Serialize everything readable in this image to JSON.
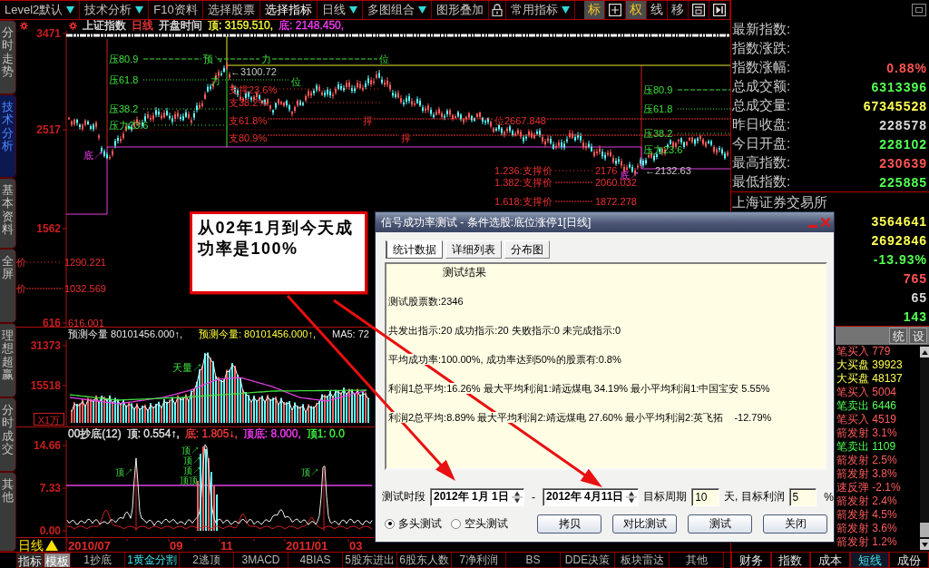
{
  "toolbar": {
    "items": [
      {
        "kind": "menu",
        "label": "Level2默认",
        "dropdown": true,
        "selected": false
      },
      {
        "kind": "menu",
        "label": "技术分析",
        "dropdown": true,
        "selected": false
      },
      {
        "kind": "menu",
        "label": "F10资料",
        "dropdown": false,
        "selected": false
      },
      {
        "kind": "menu",
        "label": "选择股票",
        "dropdown": false,
        "selected": false
      },
      {
        "kind": "menu",
        "label": "选择指标",
        "dropdown": false,
        "selected": true
      },
      {
        "kind": "menu",
        "label": "日线",
        "dropdown": true,
        "selected": false
      },
      {
        "kind": "menu",
        "label": "多图组合",
        "dropdown": true,
        "selected": false
      },
      {
        "kind": "menu",
        "label": "图形叠加",
        "dropdown": false,
        "selected": false
      },
      {
        "kind": "lock"
      },
      {
        "kind": "menu",
        "label": "常用指标",
        "dropdown": true,
        "selected": false
      }
    ],
    "tools": [
      {
        "kind": "text",
        "label": "标",
        "active": true
      },
      {
        "kind": "grid",
        "active": false
      },
      {
        "kind": "text",
        "label": "权",
        "active": true
      },
      {
        "kind": "text",
        "label": "线",
        "active": false
      },
      {
        "kind": "text",
        "label": "移",
        "active": false
      },
      {
        "kind": "window",
        "active": false
      },
      {
        "kind": "step",
        "active": false
      }
    ]
  },
  "side_tabs": [
    {
      "label": "分时走势",
      "selected": false
    },
    {
      "label": "技术分析",
      "selected": true
    },
    {
      "label": "基本资料",
      "selected": false
    },
    {
      "label": "全屏",
      "selected": false
    },
    {
      "label": "理想超赢",
      "selected": false
    },
    {
      "label": "分时成交",
      "selected": false
    },
    {
      "label": "其他",
      "selected": false
    }
  ],
  "main_chart": {
    "header": [
      {
        "text": "上证指数",
        "color": "#e8e8e8"
      },
      {
        "text": "日线",
        "color": "#ff3c3c"
      },
      {
        "text": "开盘时间",
        "color": "#e8e8e8"
      },
      {
        "text": "顶: 3159.510,",
        "color": "#ffff3c"
      },
      {
        "text": "底: 2148.450,",
        "color": "#ff3cff"
      }
    ],
    "axis_labels": [
      "3471",
      "2517",
      "1562",
      "616"
    ],
    "annotations": [
      {
        "text": "压80.9",
        "kind": "resistance"
      },
      {
        "text": "预↘",
        "kind": "resistance"
      },
      {
        "text": "力",
        "kind": "resistance"
      },
      {
        "text": "位",
        "kind": "resistance"
      },
      {
        "text": "←3100.72",
        "kind": "price"
      },
      {
        "text": "压61.8",
        "kind": "resistance"
      },
      {
        "text": "力",
        "kind": "resistance"
      },
      {
        "text": "位",
        "kind": "resistance"
      },
      {
        "text": "支撑23.6%",
        "kind": "support"
      },
      {
        "text": "支38.2%",
        "kind": "support"
      },
      {
        "text": "压38.2",
        "kind": "resistance"
      },
      {
        "text": "支61.8%",
        "kind": "support"
      },
      {
        "text": "撑",
        "kind": "support"
      },
      {
        "text": "位2667.848",
        "kind": "support"
      },
      {
        "text": "压力23.6",
        "kind": "resistance"
      },
      {
        "text": "支80.9%",
        "kind": "support"
      },
      {
        "text": "撑",
        "kind": "support"
      },
      {
        "text": "压80.9",
        "kind": "resistance"
      },
      {
        "text": "压61.8",
        "kind": "resistance"
      },
      {
        "text": "压38.2",
        "kind": "resistance"
      },
      {
        "text": "压力23.6",
        "kind": "resistance"
      },
      {
        "text": "底↗",
        "kind": "bottom"
      },
      {
        "text": "1.236:支撑价",
        "kind": "support"
      },
      {
        "text": "2176",
        "kind": "support"
      },
      {
        "text": "底↗",
        "kind": "bottom"
      },
      {
        "text": "←2132.63",
        "kind": "price"
      },
      {
        "text": "1.382:支撑价",
        "kind": "support"
      },
      {
        "text": "2060.032",
        "kind": "support"
      },
      {
        "text": "1.618:支撑价",
        "kind": "support"
      },
      {
        "text": "1872.278",
        "kind": "support"
      },
      {
        "text": "价",
        "kind": "support"
      },
      {
        "text": "1290.221",
        "kind": "support"
      },
      {
        "text": "价",
        "kind": "support"
      },
      {
        "text": "1032.569",
        "kind": "support"
      },
      {
        "text": "616.001",
        "kind": "support"
      }
    ]
  },
  "volume_chart": {
    "header": [
      {
        "text": "预测今量 80101456.000↑,",
        "color": "#e8e8e8"
      },
      {
        "text": "预测今量: 80101456.000↑,",
        "color": "#ffff3c"
      },
      {
        "text": "MA5: 72",
        "color": "#e8e8e8"
      }
    ],
    "axis_labels": [
      "31373",
      "15518"
    ],
    "unit": "X1万",
    "annotations": [
      "天量↗"
    ]
  },
  "indicator_chart": {
    "header": [
      {
        "text": "00抄底(12)",
        "color": "#e8e8e8"
      },
      {
        "text": "顶: 0.554↑,",
        "color": "#e8e8e8"
      },
      {
        "text": "底: 1.805↓,",
        "color": "#ff3c3c"
      },
      {
        "text": "顶底: 8.000,",
        "color": "#ff3cff"
      },
      {
        "text": "顶1: 0.0",
        "color": "#3cff3c"
      }
    ],
    "axis_labels": [
      "14.66",
      "7.33",
      "0.00"
    ],
    "annotations": [
      "顶↗",
      "顶↗",
      "顶↗",
      "顶↗",
      "顶顶",
      "顶↗"
    ]
  },
  "date_axis": {
    "period": "日线",
    "dates": [
      "2010/07",
      "09",
      "11",
      "2011/01",
      "03"
    ]
  },
  "bottom_bar": {
    "modes": [
      {
        "label": "指标",
        "selected": false
      },
      {
        "label": "模板",
        "selected": true
      }
    ],
    "tabs": [
      {
        "label": "1抄底",
        "selected": false
      },
      {
        "label": "1黄金分割",
        "selected": true
      },
      {
        "label": "2逃顶",
        "selected": false
      },
      {
        "label": "3MACD",
        "selected": false
      },
      {
        "label": "4BIAS",
        "selected": false
      },
      {
        "label": "5股东进出",
        "selected": false
      },
      {
        "label": "6股东人数",
        "selected": false
      },
      {
        "label": "7净利润",
        "selected": false
      },
      {
        "label": "BS",
        "selected": false
      },
      {
        "label": "DDE决策",
        "selected": false
      },
      {
        "label": "板块雷达",
        "selected": false
      },
      {
        "label": "其他",
        "selected": false
      }
    ]
  },
  "quote_panel": {
    "rows": [
      {
        "label": "最新指数:"
      },
      {
        "label": "指数涨跌:"
      },
      {
        "label": "指数涨幅:",
        "value": "0.88%",
        "color": "#ff5454"
      },
      {
        "label": "总成交额:",
        "value": "6313396",
        "color": "#54ff54"
      },
      {
        "label": "总成交量:",
        "value": "67345528",
        "color": "#ffff54"
      },
      {
        "label": "昨日收盘:",
        "value": "228578",
        "color": "#d8d8d8"
      },
      {
        "label": "今日开盘:",
        "value": "228102",
        "color": "#54ff54"
      },
      {
        "label": "最高指数:",
        "value": "230639",
        "color": "#ff5454"
      },
      {
        "label": "最低指数:",
        "value": "225885",
        "color": "#54ff54"
      }
    ],
    "exchange": "上海证券交易所",
    "values": [
      {
        "value": "3564641",
        "color": "#ffff54"
      },
      {
        "value": "2692846",
        "color": "#ffff54"
      },
      {
        "value": "-13.93%",
        "color": "#54ff54"
      },
      {
        "value": "765",
        "color": "#ff5454"
      },
      {
        "value": "65",
        "color": "#d8d8d8"
      },
      {
        "value": "143",
        "color": "#54ff54"
      }
    ]
  },
  "panel_tools": [
    "统",
    "设"
  ],
  "signals": [
    {
      "text": "笔买入 779",
      "color": "#ff5c5c"
    },
    {
      "text": "大买盘 39923",
      "color": "#ffff54"
    },
    {
      "text": "大买盘 48137",
      "color": "#ffff54"
    },
    {
      "text": "笔买入 5004",
      "color": "#ff5c5c"
    },
    {
      "text": "笔卖出 6446",
      "color": "#54ff54"
    },
    {
      "text": "笔买入 4519",
      "color": "#ff5c5c"
    },
    {
      "text": "箭发射 3.1%",
      "color": "#ff5c5c"
    },
    {
      "text": "笔卖出 1109",
      "color": "#54ff54"
    },
    {
      "text": "箭发射 2.5%",
      "color": "#ff5c5c"
    },
    {
      "text": "箭发射 3.8%",
      "color": "#ff5c5c"
    },
    {
      "text": "速反弹 -2.1%",
      "color": "#ff5c5c"
    },
    {
      "text": "箭发射 2.4%",
      "color": "#ff5c5c"
    },
    {
      "text": "箭发射 4.5%",
      "color": "#ff5c5c"
    },
    {
      "text": "箭发射 3.6%",
      "color": "#ff5c5c"
    },
    {
      "text": "箭发射 1.2%",
      "color": "#ff5c5c"
    }
  ],
  "panel_tabs": [
    {
      "label": "财务",
      "selected": false
    },
    {
      "label": "指数",
      "selected": false
    },
    {
      "label": "成本",
      "selected": false
    },
    {
      "label": "短线",
      "selected": true
    },
    {
      "label": "成份",
      "selected": false
    }
  ],
  "dialog": {
    "title": "信号成功率测试 - 条件选股:底位涨停1[日线]",
    "tabs": [
      {
        "label": "统计数据",
        "selected": true
      },
      {
        "label": "详细列表",
        "selected": false
      },
      {
        "label": "分布图",
        "selected": false
      }
    ],
    "result_title": "测试结果",
    "results": [
      "测试股票数:2346",
      "共发出指示:20 成功指示:20 失败指示:0 未完成指示:0",
      "平均成功率:100.00%, 成功率达到50%的股票有:0.8%",
      "利润1总平均:16.26% 最大平均利润1:靖远煤电 34.19% 最小平均利润1:中国宝安 5.55%",
      "利润2总平均:8.89% 最大平均利润2:靖远煤电 27.60% 最小平均利润2:英飞拓    -12.79%"
    ],
    "period_label": "测试时段",
    "start_date": "2012年 1月 1日",
    "range_separator": "-",
    "end_date": "2012年 4月11日",
    "target_period_label": "目标周期",
    "target_period": "10",
    "target_profit_label": "天, 目标利润",
    "target_profit": "5",
    "percent_sign": "%",
    "modes": [
      {
        "label": "多头测试",
        "selected": true
      },
      {
        "label": "空头测试",
        "selected": false
      }
    ],
    "buttons": [
      "拷贝",
      "对比测试",
      "测试",
      "关闭"
    ]
  },
  "callout": {
    "text": "从02年1月到今天成功率是100%"
  }
}
